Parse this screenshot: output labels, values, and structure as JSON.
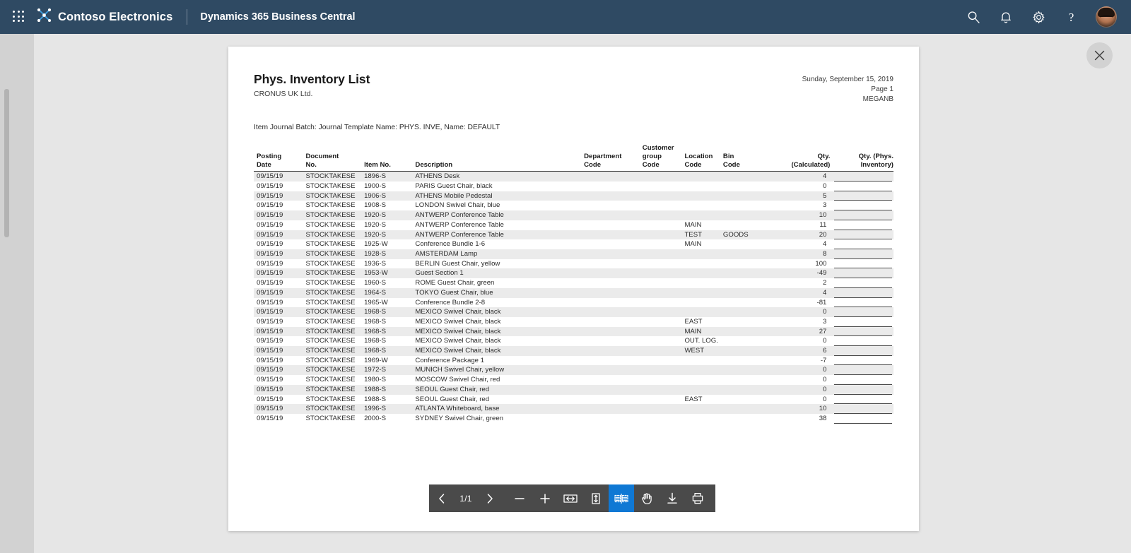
{
  "appbar": {
    "waffle_label": "App launcher",
    "brand": "Contoso Electronics",
    "app_name": "Dynamics 365 Business Central",
    "icons": [
      "search-icon",
      "bell-icon",
      "gear-icon",
      "help-icon"
    ],
    "help_glyph": "?",
    "background_color": "#2f4a63"
  },
  "viewer": {
    "close_label": "Close",
    "backdrop_color": "#e6e6e6",
    "rail_color": "#d2d2d2"
  },
  "report": {
    "title": "Phys. Inventory List",
    "company": "CRONUS UK Ltd.",
    "date": "Sunday, September 15, 2019",
    "page": "Page 1",
    "user": "MEGANB",
    "batch_line": "Item Journal Batch: Journal Template Name: PHYS. INVE, Name: DEFAULT",
    "columns": [
      {
        "key": "posting_date",
        "label": "Posting\nDate",
        "align": "left"
      },
      {
        "key": "document_no",
        "label": "Document\nNo.",
        "align": "left"
      },
      {
        "key": "item_no",
        "label": "Item No.",
        "align": "left"
      },
      {
        "key": "description",
        "label": "Description",
        "align": "left"
      },
      {
        "key": "department_code",
        "label": "Department\nCode",
        "align": "left"
      },
      {
        "key": "customer_group_code",
        "label": "Customer\ngroup\nCode",
        "align": "left"
      },
      {
        "key": "location_code",
        "label": "Location\nCode",
        "align": "left"
      },
      {
        "key": "bin_code",
        "label": "Bin\nCode",
        "align": "left"
      },
      {
        "key": "qty_calculated",
        "label": "Qty.\n(Calculated)",
        "align": "right"
      },
      {
        "key": "qty_phys_inventory",
        "label": "Qty. (Phys.\nInventory)",
        "align": "right"
      }
    ],
    "rows": [
      {
        "posting_date": "09/15/19",
        "document_no": "STOCKTAKESE",
        "item_no": "1896-S",
        "description": "ATHENS Desk",
        "department_code": "",
        "customer_group_code": "",
        "location_code": "",
        "bin_code": "",
        "qty_calculated": "4",
        "qty_phys_inventory": ""
      },
      {
        "posting_date": "09/15/19",
        "document_no": "STOCKTAKESE",
        "item_no": "1900-S",
        "description": "PARIS Guest Chair, black",
        "department_code": "",
        "customer_group_code": "",
        "location_code": "",
        "bin_code": "",
        "qty_calculated": "0",
        "qty_phys_inventory": ""
      },
      {
        "posting_date": "09/15/19",
        "document_no": "STOCKTAKESE",
        "item_no": "1906-S",
        "description": "ATHENS Mobile Pedestal",
        "department_code": "",
        "customer_group_code": "",
        "location_code": "",
        "bin_code": "",
        "qty_calculated": "5",
        "qty_phys_inventory": ""
      },
      {
        "posting_date": "09/15/19",
        "document_no": "STOCKTAKESE",
        "item_no": "1908-S",
        "description": "LONDON Swivel Chair, blue",
        "department_code": "",
        "customer_group_code": "",
        "location_code": "",
        "bin_code": "",
        "qty_calculated": "3",
        "qty_phys_inventory": ""
      },
      {
        "posting_date": "09/15/19",
        "document_no": "STOCKTAKESE",
        "item_no": "1920-S",
        "description": "ANTWERP Conference Table",
        "department_code": "",
        "customer_group_code": "",
        "location_code": "",
        "bin_code": "",
        "qty_calculated": "10",
        "qty_phys_inventory": ""
      },
      {
        "posting_date": "09/15/19",
        "document_no": "STOCKTAKESE",
        "item_no": "1920-S",
        "description": "ANTWERP Conference Table",
        "department_code": "",
        "customer_group_code": "",
        "location_code": "MAIN",
        "bin_code": "",
        "qty_calculated": "11",
        "qty_phys_inventory": ""
      },
      {
        "posting_date": "09/15/19",
        "document_no": "STOCKTAKESE",
        "item_no": "1920-S",
        "description": "ANTWERP Conference Table",
        "department_code": "",
        "customer_group_code": "",
        "location_code": "TEST",
        "bin_code": "GOODS",
        "qty_calculated": "20",
        "qty_phys_inventory": ""
      },
      {
        "posting_date": "09/15/19",
        "document_no": "STOCKTAKESE",
        "item_no": "1925-W",
        "description": "Conference Bundle 1-6",
        "department_code": "",
        "customer_group_code": "",
        "location_code": "MAIN",
        "bin_code": "",
        "qty_calculated": "4",
        "qty_phys_inventory": ""
      },
      {
        "posting_date": "09/15/19",
        "document_no": "STOCKTAKESE",
        "item_no": "1928-S",
        "description": "AMSTERDAM Lamp",
        "department_code": "",
        "customer_group_code": "",
        "location_code": "",
        "bin_code": "",
        "qty_calculated": "8",
        "qty_phys_inventory": ""
      },
      {
        "posting_date": "09/15/19",
        "document_no": "STOCKTAKESE",
        "item_no": "1936-S",
        "description": "BERLIN Guest Chair, yellow",
        "department_code": "",
        "customer_group_code": "",
        "location_code": "",
        "bin_code": "",
        "qty_calculated": "100",
        "qty_phys_inventory": ""
      },
      {
        "posting_date": "09/15/19",
        "document_no": "STOCKTAKESE",
        "item_no": "1953-W",
        "description": "Guest Section 1",
        "department_code": "",
        "customer_group_code": "",
        "location_code": "",
        "bin_code": "",
        "qty_calculated": "-49",
        "qty_phys_inventory": ""
      },
      {
        "posting_date": "09/15/19",
        "document_no": "STOCKTAKESE",
        "item_no": "1960-S",
        "description": "ROME Guest Chair, green",
        "department_code": "",
        "customer_group_code": "",
        "location_code": "",
        "bin_code": "",
        "qty_calculated": "2",
        "qty_phys_inventory": ""
      },
      {
        "posting_date": "09/15/19",
        "document_no": "STOCKTAKESE",
        "item_no": "1964-S",
        "description": "TOKYO Guest Chair, blue",
        "department_code": "",
        "customer_group_code": "",
        "location_code": "",
        "bin_code": "",
        "qty_calculated": "4",
        "qty_phys_inventory": ""
      },
      {
        "posting_date": "09/15/19",
        "document_no": "STOCKTAKESE",
        "item_no": "1965-W",
        "description": "Conference Bundle 2-8",
        "department_code": "",
        "customer_group_code": "",
        "location_code": "",
        "bin_code": "",
        "qty_calculated": "-81",
        "qty_phys_inventory": ""
      },
      {
        "posting_date": "09/15/19",
        "document_no": "STOCKTAKESE",
        "item_no": "1968-S",
        "description": "MEXICO Swivel Chair, black",
        "department_code": "",
        "customer_group_code": "",
        "location_code": "",
        "bin_code": "",
        "qty_calculated": "0",
        "qty_phys_inventory": ""
      },
      {
        "posting_date": "09/15/19",
        "document_no": "STOCKTAKESE",
        "item_no": "1968-S",
        "description": "MEXICO Swivel Chair, black",
        "department_code": "",
        "customer_group_code": "",
        "location_code": "EAST",
        "bin_code": "",
        "qty_calculated": "3",
        "qty_phys_inventory": ""
      },
      {
        "posting_date": "09/15/19",
        "document_no": "STOCKTAKESE",
        "item_no": "1968-S",
        "description": "MEXICO Swivel Chair, black",
        "department_code": "",
        "customer_group_code": "",
        "location_code": "MAIN",
        "bin_code": "",
        "qty_calculated": "27",
        "qty_phys_inventory": ""
      },
      {
        "posting_date": "09/15/19",
        "document_no": "STOCKTAKESE",
        "item_no": "1968-S",
        "description": "MEXICO Swivel Chair, black",
        "department_code": "",
        "customer_group_code": "",
        "location_code": "OUT. LOG.",
        "bin_code": "",
        "qty_calculated": "0",
        "qty_phys_inventory": ""
      },
      {
        "posting_date": "09/15/19",
        "document_no": "STOCKTAKESE",
        "item_no": "1968-S",
        "description": "MEXICO Swivel Chair, black",
        "department_code": "",
        "customer_group_code": "",
        "location_code": "WEST",
        "bin_code": "",
        "qty_calculated": "6",
        "qty_phys_inventory": ""
      },
      {
        "posting_date": "09/15/19",
        "document_no": "STOCKTAKESE",
        "item_no": "1969-W",
        "description": "Conference Package 1",
        "department_code": "",
        "customer_group_code": "",
        "location_code": "",
        "bin_code": "",
        "qty_calculated": "-7",
        "qty_phys_inventory": ""
      },
      {
        "posting_date": "09/15/19",
        "document_no": "STOCKTAKESE",
        "item_no": "1972-S",
        "description": "MUNICH Swivel Chair, yellow",
        "department_code": "",
        "customer_group_code": "",
        "location_code": "",
        "bin_code": "",
        "qty_calculated": "0",
        "qty_phys_inventory": ""
      },
      {
        "posting_date": "09/15/19",
        "document_no": "STOCKTAKESE",
        "item_no": "1980-S",
        "description": "MOSCOW Swivel Chair, red",
        "department_code": "",
        "customer_group_code": "",
        "location_code": "",
        "bin_code": "",
        "qty_calculated": "0",
        "qty_phys_inventory": ""
      },
      {
        "posting_date": "09/15/19",
        "document_no": "STOCKTAKESE",
        "item_no": "1988-S",
        "description": "SEOUL Guest Chair, red",
        "department_code": "",
        "customer_group_code": "",
        "location_code": "",
        "bin_code": "",
        "qty_calculated": "0",
        "qty_phys_inventory": ""
      },
      {
        "posting_date": "09/15/19",
        "document_no": "STOCKTAKESE",
        "item_no": "1988-S",
        "description": "SEOUL Guest Chair, red",
        "department_code": "",
        "customer_group_code": "",
        "location_code": "EAST",
        "bin_code": "",
        "qty_calculated": "0",
        "qty_phys_inventory": ""
      },
      {
        "posting_date": "09/15/19",
        "document_no": "STOCKTAKESE",
        "item_no": "1996-S",
        "description": "ATLANTA Whiteboard, base",
        "department_code": "",
        "customer_group_code": "",
        "location_code": "",
        "bin_code": "",
        "qty_calculated": "10",
        "qty_phys_inventory": ""
      },
      {
        "posting_date": "09/15/19",
        "document_no": "STOCKTAKESE",
        "item_no": "2000-S",
        "description": "SYDNEY Swivel Chair, green",
        "department_code": "",
        "customer_group_code": "",
        "location_code": "",
        "bin_code": "",
        "qty_calculated": "38",
        "qty_phys_inventory": ""
      }
    ]
  },
  "toolbar": {
    "page_indicator": "1/1",
    "previous_label": "Previous page",
    "next_label": "Next page",
    "zoom_out_label": "Zoom out",
    "zoom_in_label": "Zoom in",
    "fit_width_label": "Fit to width",
    "fit_page_label": "Fit to page",
    "layout_label": "Page layout",
    "pan_label": "Pan",
    "download_label": "Download",
    "print_label": "Print",
    "active_tool": "layout",
    "active_color": "#0f78d4",
    "background_color": "#4a4a4a"
  }
}
